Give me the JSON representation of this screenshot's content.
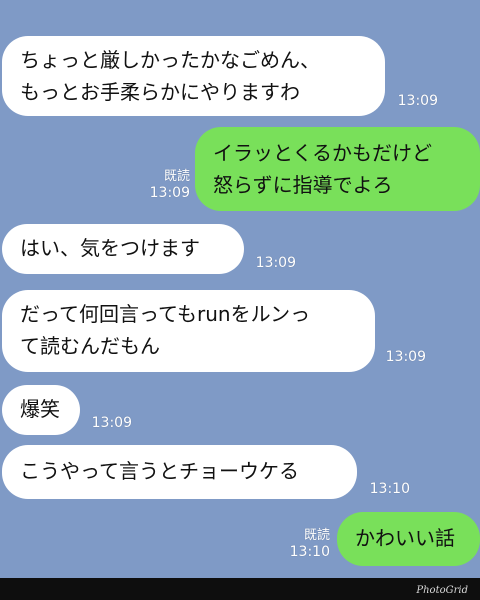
{
  "messages": [
    {
      "id": 1,
      "side": "in",
      "lines": [
        "ちょっと厳しかったかなごめん、",
        "もっとお手柔らかにやりますわ"
      ],
      "time": "13:09",
      "read": ""
    },
    {
      "id": 2,
      "side": "out",
      "lines": [
        "イラッとくるかもだけど",
        "怒らずに指導でよろ"
      ],
      "time": "13:09",
      "read": "既読"
    },
    {
      "id": 3,
      "side": "in",
      "lines": [
        "はい、気をつけます"
      ],
      "time": "13:09",
      "read": ""
    },
    {
      "id": 4,
      "side": "in",
      "lines": [
        "だって何回言ってもrunをルンっ",
        "て読むんだもん"
      ],
      "time": "13:09",
      "read": ""
    },
    {
      "id": 5,
      "side": "in",
      "lines": [
        "爆笑"
      ],
      "time": "13:09",
      "read": ""
    },
    {
      "id": 6,
      "side": "in",
      "lines": [
        "こうやって言うとチョーウケる"
      ],
      "time": "13:10",
      "read": ""
    },
    {
      "id": 7,
      "side": "out",
      "lines": [
        "かわいい話"
      ],
      "time": "13:10",
      "read": "既読"
    }
  ],
  "watermark": "PhotoGrid",
  "colors": {
    "background": "#7f9ac6",
    "incoming_bubble": "#ffffff",
    "outgoing_bubble": "#79e05a",
    "meta_text": "#ffffff"
  }
}
